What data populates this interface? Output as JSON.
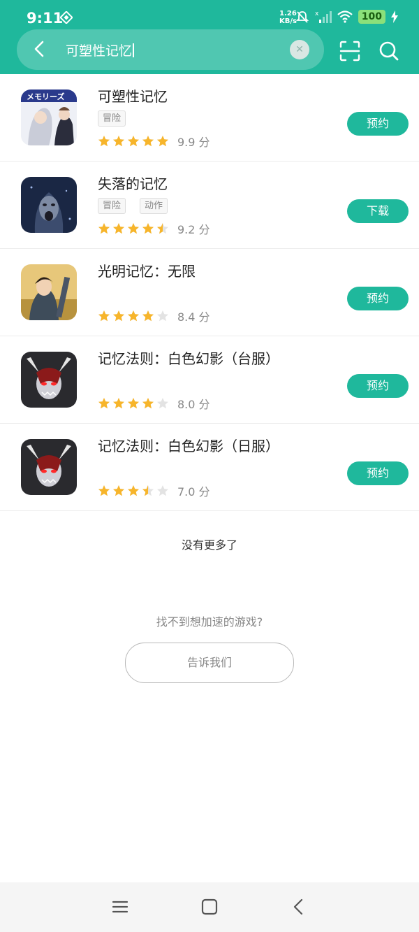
{
  "status": {
    "time": "9:11",
    "net_speed_value": "1.26",
    "net_speed_unit": "KB/s",
    "battery": "100"
  },
  "search": {
    "query": "可塑性记忆"
  },
  "results": [
    {
      "name": "可塑性记忆",
      "tags": [
        "冒险"
      ],
      "rating": 5,
      "score": "9.9 分",
      "action": "预约"
    },
    {
      "name": "失落的记忆",
      "tags": [
        "冒险",
        "动作"
      ],
      "rating": 4.5,
      "score": "9.2 分",
      "action": "下载"
    },
    {
      "name": "光明记忆：无限",
      "tags": [],
      "rating": 4,
      "score": "8.4 分",
      "action": "预约"
    },
    {
      "name": "记忆法则：白色幻影（台服）",
      "tags": [],
      "rating": 4,
      "score": "8.0 分",
      "action": "预约"
    },
    {
      "name": "记忆法则：白色幻影（日服）",
      "tags": [],
      "rating": 3.5,
      "score": "7.0 分",
      "action": "预约"
    }
  ],
  "footer": {
    "no_more": "没有更多了",
    "cant_find": "找不到想加速的游戏?",
    "tell_us": "告诉我们"
  },
  "colors": {
    "accent": "#1fb89c",
    "star": "#f7b52b",
    "star_empty": "#e3e3e3"
  }
}
